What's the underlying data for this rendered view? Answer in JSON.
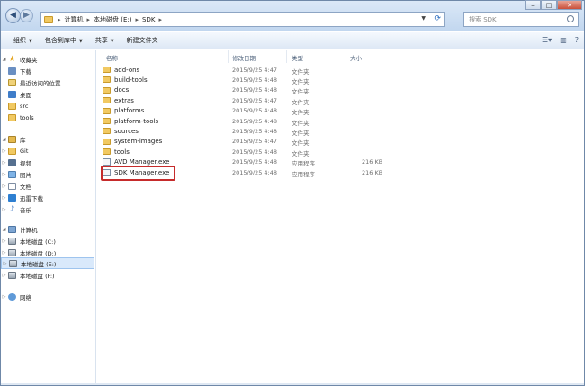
{
  "address": {
    "crumbs": [
      "计算机",
      "本地磁盘 (E:)",
      "SDK"
    ]
  },
  "search": {
    "placeholder": "搜索 SDK"
  },
  "toolbar": {
    "organize": "组织",
    "include": "包含到库中",
    "share": "共享",
    "new_folder": "新建文件夹"
  },
  "nav": {
    "favorites": "收藏夹",
    "fav_items": [
      "下载",
      "最近访问的位置",
      "桌面",
      "src",
      "tools"
    ],
    "library": "库",
    "lib_items": [
      "Git",
      "视频",
      "图片",
      "文档",
      "迅雷下载",
      "音乐"
    ],
    "computer": "计算机",
    "drives": [
      "本地磁盘 (C:)",
      "本地磁盘 (D:)",
      "本地磁盘 (E:)",
      "本地磁盘 (F:)"
    ],
    "network": "网络"
  },
  "columns": {
    "name": "名称",
    "modified": "修改日期",
    "type": "类型",
    "size": "大小"
  },
  "files": [
    {
      "name": "add-ons",
      "date": "2015/9/25 4:47",
      "type": "文件夹",
      "size": "",
      "kind": "folder"
    },
    {
      "name": "build-tools",
      "date": "2015/9/25 4:48",
      "type": "文件夹",
      "size": "",
      "kind": "folder"
    },
    {
      "name": "docs",
      "date": "2015/9/25 4:48",
      "type": "文件夹",
      "size": "",
      "kind": "folder"
    },
    {
      "name": "extras",
      "date": "2015/9/25 4:47",
      "type": "文件夹",
      "size": "",
      "kind": "folder"
    },
    {
      "name": "platforms",
      "date": "2015/9/25 4:48",
      "type": "文件夹",
      "size": "",
      "kind": "folder"
    },
    {
      "name": "platform-tools",
      "date": "2015/9/25 4:48",
      "type": "文件夹",
      "size": "",
      "kind": "folder"
    },
    {
      "name": "sources",
      "date": "2015/9/25 4:48",
      "type": "文件夹",
      "size": "",
      "kind": "folder"
    },
    {
      "name": "system-images",
      "date": "2015/9/25 4:47",
      "type": "文件夹",
      "size": "",
      "kind": "folder"
    },
    {
      "name": "tools",
      "date": "2015/9/25 4:48",
      "type": "文件夹",
      "size": "",
      "kind": "folder"
    },
    {
      "name": "AVD Manager.exe",
      "date": "2015/9/25 4:48",
      "type": "应用程序",
      "size": "216 KB",
      "kind": "exe"
    },
    {
      "name": "SDK Manager.exe",
      "date": "2015/9/25 4:48",
      "type": "应用程序",
      "size": "216 KB",
      "kind": "exe"
    }
  ],
  "colors": {
    "highlight": "#c62b2b",
    "selected": "#d9e9fb"
  }
}
